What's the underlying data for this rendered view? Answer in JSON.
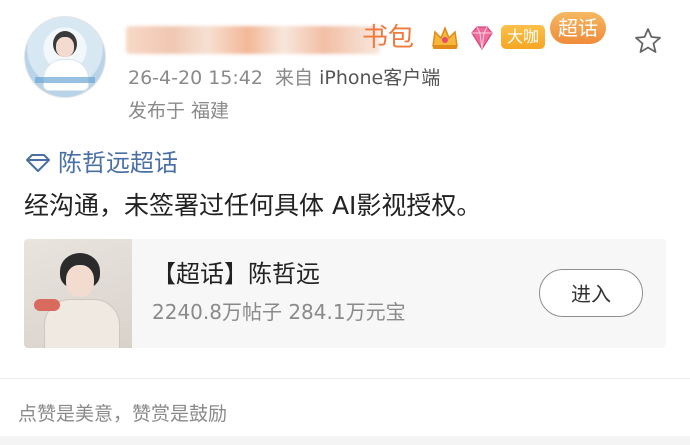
{
  "header": {
    "username_suffix": "书包",
    "badge_dakai": "大咖",
    "badge_chaohua": "超话",
    "timestamp": "26-4-20 15:42",
    "source_prefix": "来自",
    "source": "iPhone客户端",
    "location": "发布于 福建"
  },
  "post": {
    "topic": "陈哲远超话",
    "text": "经沟通，未签署过任何具体 AI影视授权。"
  },
  "card": {
    "title": "【超话】陈哲远",
    "subtitle": "2240.8万帖子  284.1万元宝",
    "button": "进入"
  },
  "footer": {
    "text": "点赞是美意，赞赏是鼓励"
  },
  "icons": {
    "crown": "crown-icon",
    "gem": "diamond-icon",
    "star": "star-icon",
    "topic": "diamond-icon"
  },
  "colors": {
    "link": "#4a6fa5",
    "username": "#f07a3e",
    "badge_orange": "#f5a623"
  }
}
